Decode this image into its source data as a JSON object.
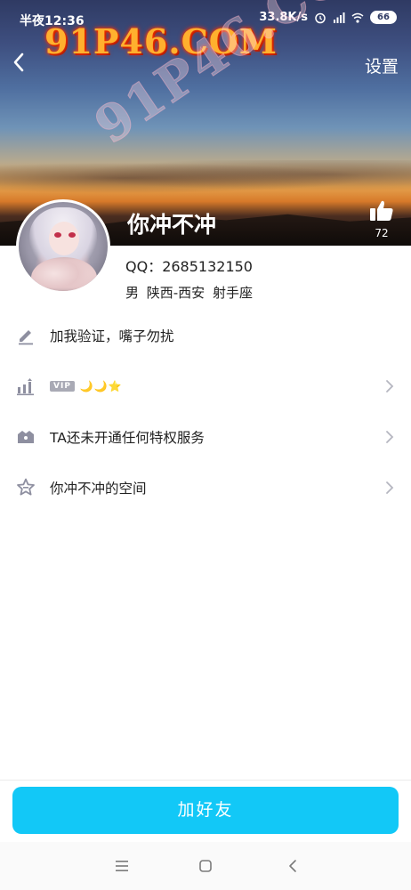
{
  "status_bar": {
    "time": "半夜12:36",
    "network_speed": "33.8K/s",
    "battery": "66"
  },
  "watermark": {
    "top": "91P46.COM",
    "diagonal": "91P46.COM"
  },
  "header": {
    "settings_label": "设置"
  },
  "profile": {
    "name": "你冲不冲",
    "likes": "72",
    "qq": "QQ：2685132150",
    "meta": "男  陕西-西安  射手座"
  },
  "rows": [
    {
      "icon": "pencil-icon",
      "label": "加我验证，嘴子勿扰",
      "has_chevron": false
    },
    {
      "icon": "rank-icon",
      "vip_tag": "VIP",
      "badges": "🌙🌙⭐",
      "has_chevron": true
    },
    {
      "icon": "crown-box-icon",
      "label": "TA还未开通任何特权服务",
      "has_chevron": true
    },
    {
      "icon": "star-badge-icon",
      "label": "你冲不冲的空间",
      "has_chevron": true
    }
  ],
  "actions": {
    "add_friend": "加好友"
  },
  "colors": {
    "accent": "#12c8f7",
    "icon_gray": "#8e8fa0",
    "vip_tag_bg": "#a9aab5"
  }
}
